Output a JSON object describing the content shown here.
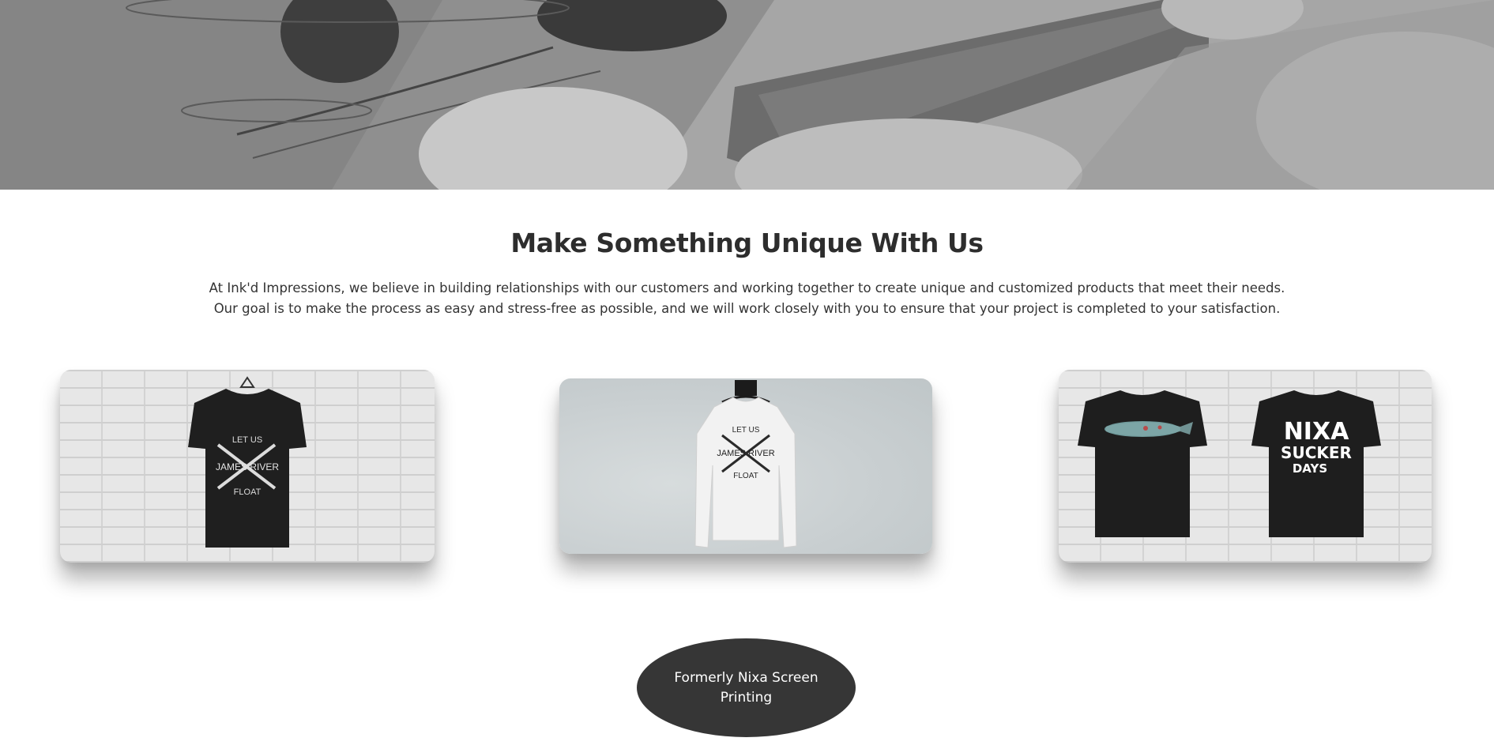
{
  "hero": {
    "image": "screen-printing-squeegee-photo"
  },
  "main": {
    "title": "Make Something Unique With Us",
    "intro_line_1": "At Ink'd Impressions, we believe in building relationships with our customers and working together to create unique and customized products that meet their needs.",
    "intro_line_2": "Our goal is to make the process as easy and stress-free as possible, and we will work closely with you to ensure that your project is completed to your satisfaction."
  },
  "cards": [
    {
      "image": "black-tshirt-on-brick-wall",
      "shirt_print": "LET US JAMES RIVER FLOAT"
    },
    {
      "image": "white-sweatshirt-on-concrete-wall",
      "shirt_print": "LET US JAMES RIVER FLOAT"
    },
    {
      "image": "two-black-tshirts-on-brick-wall",
      "shirt_print_1": "fish-graphic",
      "shirt_print_2_line_1": "NIXA",
      "shirt_print_2_line_2": "SUCKER",
      "shirt_print_2_line_3": "DAYS"
    }
  ],
  "cta": {
    "label": "Formerly Nixa Screen Printing"
  },
  "colors": {
    "cta_bg": "#363636",
    "title": "#2d2d2d",
    "body_text": "#333333"
  }
}
